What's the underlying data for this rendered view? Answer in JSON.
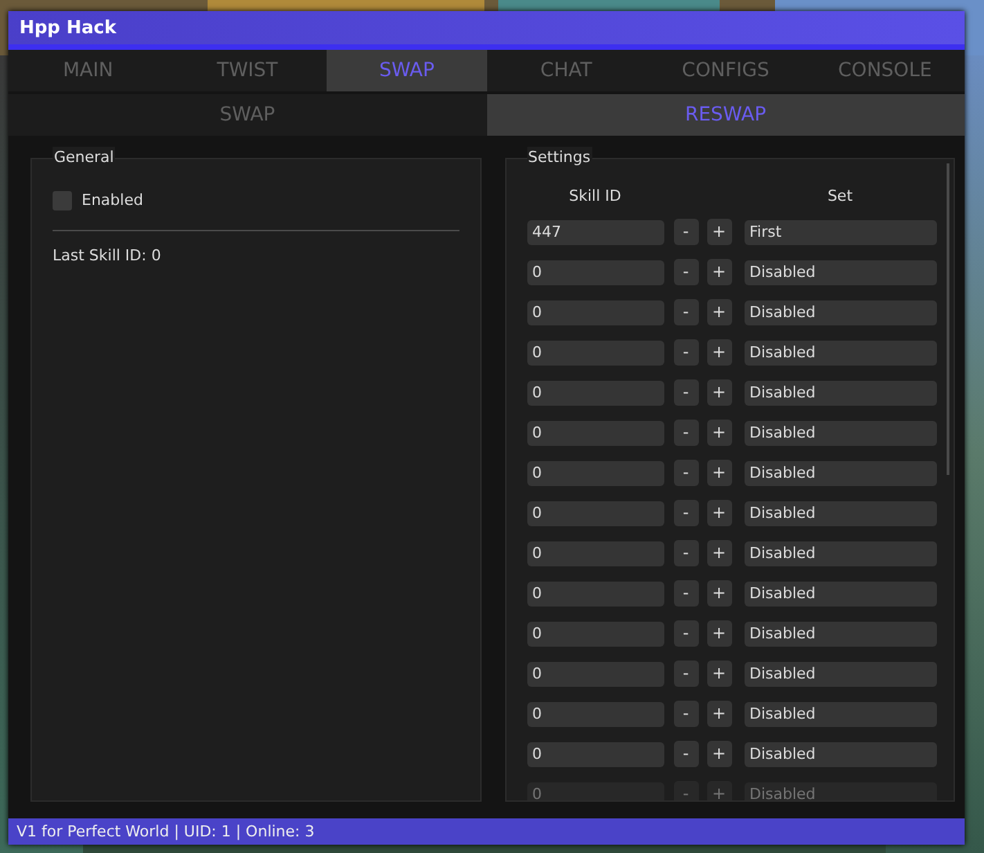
{
  "window": {
    "title": "Hpp Hack"
  },
  "tabs": [
    {
      "label": "MAIN",
      "selected": false
    },
    {
      "label": "TWIST",
      "selected": false
    },
    {
      "label": "SWAP",
      "selected": true
    },
    {
      "label": "CHAT",
      "selected": false
    },
    {
      "label": "CONFIGS",
      "selected": false
    },
    {
      "label": "CONSOLE",
      "selected": false
    }
  ],
  "subtabs": [
    {
      "label": "SWAP",
      "selected": false
    },
    {
      "label": "RESWAP",
      "selected": true
    }
  ],
  "general": {
    "title": "General",
    "enabled": {
      "label": "Enabled",
      "checked": false
    },
    "last_skill": "Last Skill ID: 0"
  },
  "settings": {
    "title": "Settings",
    "columns": [
      "Skill ID",
      "Set"
    ],
    "minus": "-",
    "plus": "+",
    "rows": [
      {
        "skill_id": "447",
        "set": "First"
      },
      {
        "skill_id": "0",
        "set": "Disabled"
      },
      {
        "skill_id": "0",
        "set": "Disabled"
      },
      {
        "skill_id": "0",
        "set": "Disabled"
      },
      {
        "skill_id": "0",
        "set": "Disabled"
      },
      {
        "skill_id": "0",
        "set": "Disabled"
      },
      {
        "skill_id": "0",
        "set": "Disabled"
      },
      {
        "skill_id": "0",
        "set": "Disabled"
      },
      {
        "skill_id": "0",
        "set": "Disabled"
      },
      {
        "skill_id": "0",
        "set": "Disabled"
      },
      {
        "skill_id": "0",
        "set": "Disabled"
      },
      {
        "skill_id": "0",
        "set": "Disabled"
      },
      {
        "skill_id": "0",
        "set": "Disabled"
      },
      {
        "skill_id": "0",
        "set": "Disabled"
      },
      {
        "skill_id": "0",
        "set": "Disabled"
      }
    ]
  },
  "status_bar": "V1 for Perfect World | UID: 1 | Online: 3"
}
